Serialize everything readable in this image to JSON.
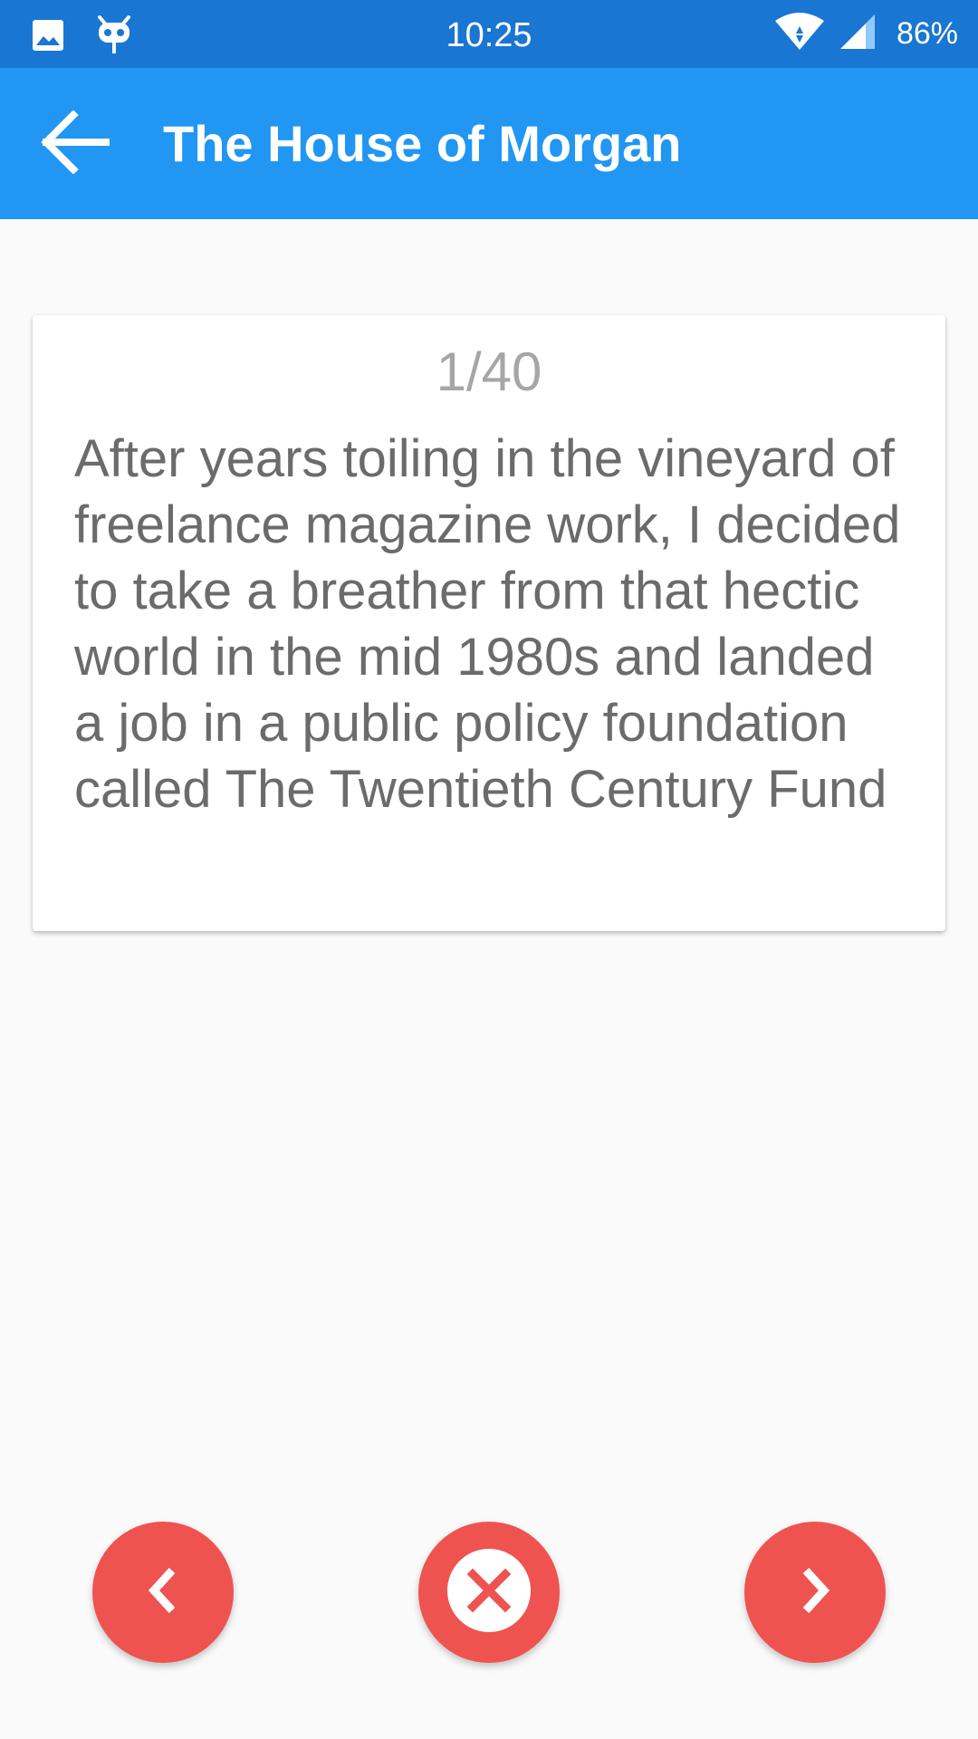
{
  "status_bar": {
    "time": "10:25",
    "battery": "86%",
    "icons": [
      "image-icon",
      "android-icon",
      "wifi-icon",
      "signal-icon"
    ]
  },
  "app_bar": {
    "title": "The House of Morgan",
    "back_icon": "arrow-left-icon"
  },
  "card": {
    "counter": "1/40",
    "passage": "After years toiling in the vineyard of freelance magazine work, I decided to take a breather from that hectic world in the mid 1980s and landed a job in a public policy foundation called The Twentieth Century Fund"
  },
  "controls": {
    "prev_icon": "chevron-left-icon",
    "close_icon": "close-circle-icon",
    "next_icon": "chevron-right-icon"
  },
  "colors": {
    "status_bar": "#1976d2",
    "app_bar": "#2196f3",
    "fab": "#ef5350",
    "background": "#fafafa",
    "passage_text": "#6b6b6b",
    "counter_text": "#a6a6a6"
  }
}
